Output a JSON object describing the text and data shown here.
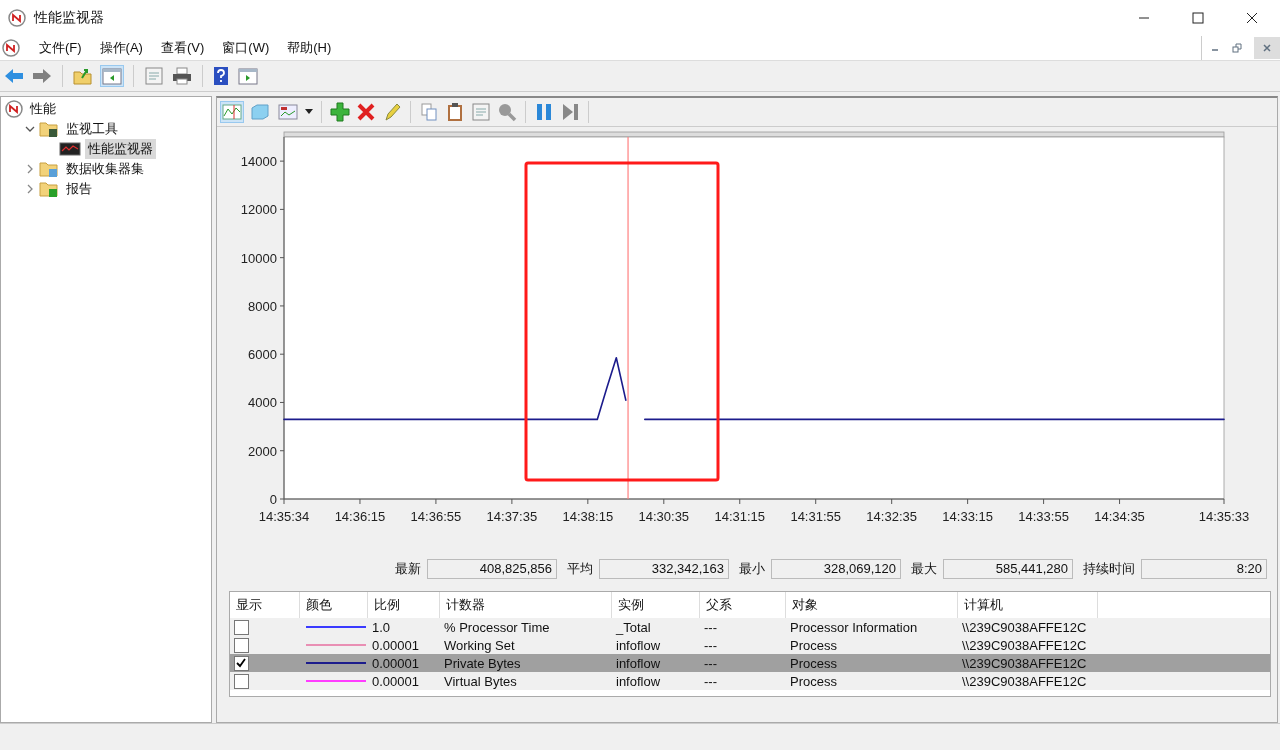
{
  "window": {
    "title": "性能监视器"
  },
  "menu": [
    "文件(F)",
    "操作(A)",
    "查看(V)",
    "窗口(W)",
    "帮助(H)"
  ],
  "tree": {
    "items": [
      {
        "label": "性能",
        "kind": "root",
        "selected": false,
        "children": [
          {
            "label": "监视工具",
            "kind": "folder-monitor",
            "expanded": true,
            "selected": false,
            "children": [
              {
                "label": "性能监视器",
                "kind": "monitor",
                "selected": true
              }
            ]
          },
          {
            "label": "数据收集器集",
            "kind": "folder-collector",
            "expanded": false,
            "selected": false
          },
          {
            "label": "报告",
            "kind": "folder-report",
            "expanded": false,
            "selected": false
          }
        ]
      }
    ]
  },
  "chart": {
    "cursor": {
      "level": 0.366
    },
    "chart_data": {
      "type": "line",
      "ylim": [
        0,
        15000
      ],
      "yticks": [
        0,
        2000,
        4000,
        6000,
        8000,
        10000,
        12000,
        14000
      ],
      "categories": [
        "14:35:34",
        null,
        null,
        null,
        null,
        null,
        null,
        null,
        "14:36:15",
        null,
        null,
        null,
        null,
        null,
        null,
        null,
        "14:36:55",
        null,
        null,
        null,
        null,
        null,
        null,
        null,
        "14:37:35",
        null,
        null,
        null,
        null,
        null,
        null,
        null,
        "14:38:15",
        null,
        null,
        null,
        null,
        null,
        null,
        null,
        "14:30:35",
        null,
        null,
        null,
        null,
        null,
        null,
        null,
        "14:31:15",
        null,
        null,
        null,
        null,
        null,
        null,
        null,
        "14:31:55",
        null,
        null,
        null,
        null,
        null,
        null,
        null,
        "14:32:35",
        null,
        null,
        null,
        null,
        null,
        null,
        null,
        "14:33:15",
        null,
        null,
        null,
        null,
        null,
        null,
        null,
        "14:33:55",
        null,
        null,
        null,
        null,
        null,
        null,
        null,
        "14:34:35",
        null,
        null,
        null,
        null,
        null,
        null,
        null,
        null,
        null,
        null,
        "14:35:33"
      ],
      "series": [
        {
          "color": "#1c1c8c",
          "values": [
            3300,
            3300,
            3300,
            3300,
            3300,
            3300,
            3300,
            3300,
            3300,
            3300,
            3300,
            3300,
            3300,
            3300,
            3300,
            3300,
            3300,
            3300,
            3300,
            3300,
            3300,
            3300,
            3300,
            3300,
            3300,
            3300,
            3300,
            3300,
            3300,
            3300,
            3300,
            3300,
            3300,
            3300,
            4600,
            5850,
            4100,
            null,
            3300,
            3300,
            3300,
            3300,
            3300,
            3300,
            3300,
            3300,
            3300,
            3300,
            3300,
            3300,
            3300,
            3300,
            3300,
            3300,
            3300,
            3300,
            3300,
            3300,
            3300,
            3300,
            3300,
            3300,
            3300,
            3300,
            3300,
            3300,
            3300,
            3300,
            3300,
            3300,
            3300,
            3300,
            3300,
            3300,
            3300,
            3300,
            3300,
            3300,
            3300,
            3300,
            3300,
            3300,
            3300,
            3300,
            3300,
            3300,
            3300,
            3300,
            3300,
            3300,
            3300,
            3300,
            3300,
            3300,
            3300,
            3300,
            3300,
            3300,
            3300,
            3300
          ]
        }
      ]
    }
  },
  "stats": [
    {
      "label": "最新",
      "value": "408,825,856"
    },
    {
      "label": "平均",
      "value": "332,342,163"
    },
    {
      "label": "最小",
      "value": "328,069,120"
    },
    {
      "label": "最大",
      "value": "585,441,280"
    },
    {
      "label": "持续时间",
      "value": "8:20"
    }
  ],
  "legend": {
    "columns": [
      "显示",
      "颜色",
      "比例",
      "计数器",
      "实例",
      "父系",
      "对象",
      "计算机"
    ],
    "rows": [
      {
        "show": false,
        "color": "#3a3aff",
        "scale": "1.0",
        "counter": "% Processor Time",
        "instance": "_Total",
        "parent": "---",
        "object": "Processor Information",
        "computer": "\\\\239C9038AFFE12C",
        "selected": false
      },
      {
        "show": false,
        "color": "#e98fb4",
        "scale": "0.00001",
        "counter": "Working Set",
        "instance": "infoflow",
        "parent": "---",
        "object": "Process",
        "computer": "\\\\239C9038AFFE12C",
        "selected": false
      },
      {
        "show": true,
        "color": "#1c1c8c",
        "scale": "0.00001",
        "counter": "Private Bytes",
        "instance": "infoflow",
        "parent": "---",
        "object": "Process",
        "computer": "\\\\239C9038AFFE12C",
        "selected": true
      },
      {
        "show": false,
        "color": "#ff3cff",
        "scale": "0.00001",
        "counter": "Virtual Bytes",
        "instance": "infoflow",
        "parent": "---",
        "object": "Process",
        "computer": "\\\\239C9038AFFE12C",
        "selected": false
      }
    ]
  }
}
